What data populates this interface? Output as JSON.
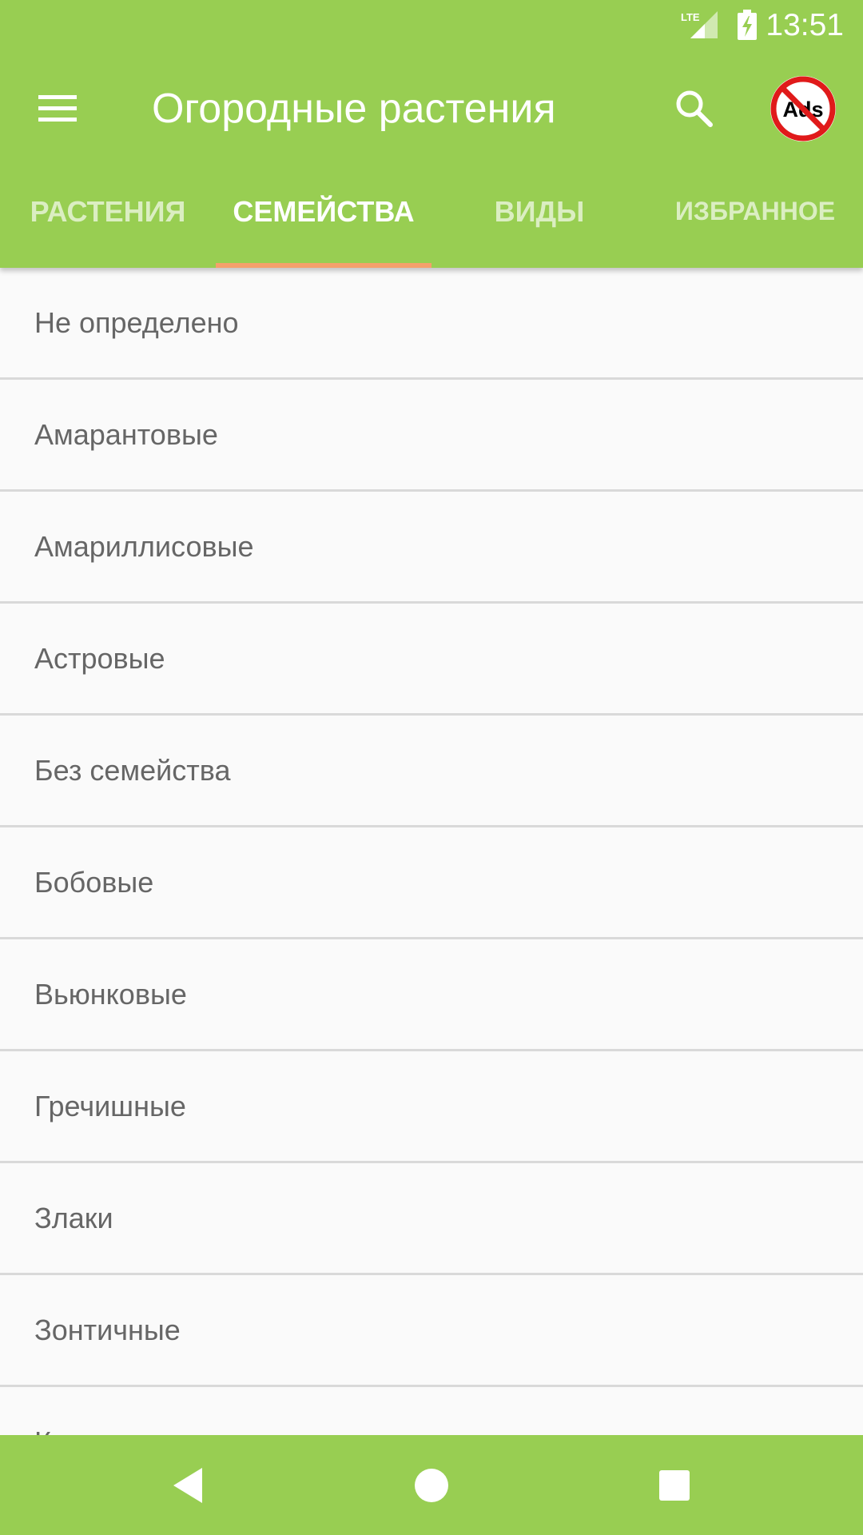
{
  "status_bar": {
    "time": "13:51",
    "network": "LTE",
    "icons": [
      "signal-icon",
      "battery-charging-icon"
    ]
  },
  "toolbar": {
    "title": "Огородные растения",
    "menu_icon": "hamburger-menu-icon",
    "search_icon": "search-icon",
    "noads_text": "Ads"
  },
  "tabs": [
    {
      "label": "РАСТЕНИЯ",
      "active": false
    },
    {
      "label": "СЕМЕЙСТВА",
      "active": true
    },
    {
      "label": "ВИДЫ",
      "active": false
    },
    {
      "label": "ИЗБРАННОЕ",
      "active": false
    }
  ],
  "families": [
    "Не определено",
    "Амарантовые",
    "Амариллисовые",
    "Астровые",
    "Без семейства",
    "Бобовые",
    "Вьюнковые",
    "Гречишные",
    "Злаки",
    "Зонтичные",
    "Капустные"
  ],
  "nav_bar": {
    "icons": [
      "back-icon",
      "home-icon",
      "recents-icon"
    ]
  },
  "colors": {
    "primary": "#98CE52",
    "accent": "#F5A06B",
    "background": "#FAFAFA",
    "divider": "#D9D9D9",
    "item_text": "#666666"
  }
}
